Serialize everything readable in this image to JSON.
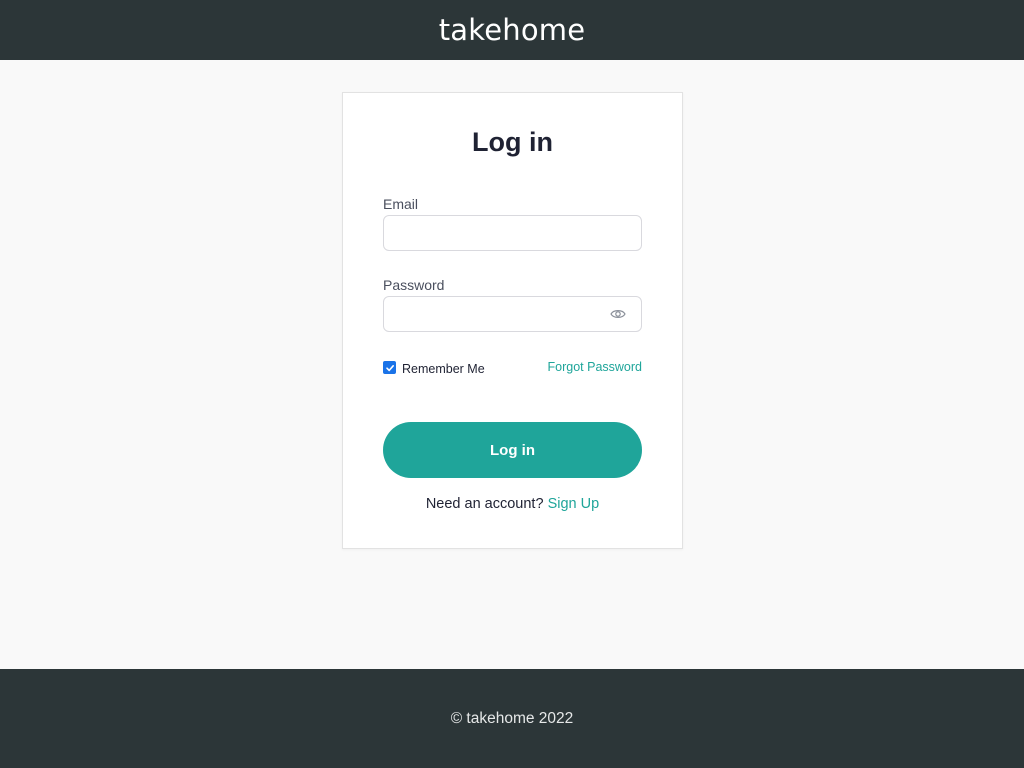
{
  "header": {
    "brand": "takehome"
  },
  "login": {
    "title": "Log in",
    "email_label": "Email",
    "email_value": "",
    "password_label": "Password",
    "password_value": "",
    "password_toggle_icon": "eye-icon",
    "remember_label": "Remember Me",
    "remember_checked": true,
    "forgot_label": "Forgot Password",
    "submit_label": "Log in",
    "signup_prompt": "Need an account?",
    "signup_label": "Sign Up"
  },
  "footer": {
    "text": "© takehome 2022"
  },
  "colors": {
    "header_bg": "#2c3638",
    "accent": "#1fa59a",
    "checkbox": "#1a73e8",
    "page_bg": "#f9f9f9"
  }
}
